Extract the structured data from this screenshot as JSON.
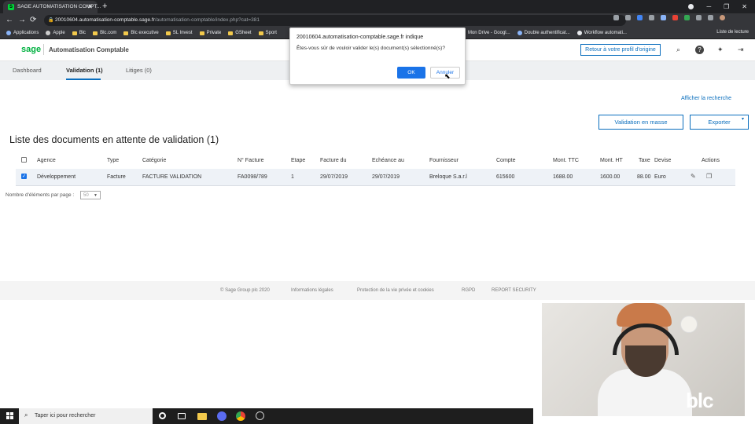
{
  "browser": {
    "tab_title": "SAGE AUTOMATISATION COMPT...",
    "url_host": "20010604.automatisation-comptable.sage.fr",
    "url_path": "/automatisation-comptable/index.php?cat=381",
    "bookmarks": [
      "Applications",
      "Apple",
      "Blc",
      "Blc.com",
      "Blc executive",
      "SL Invest",
      "Private",
      "GSheet",
      "Sport",
      "Mon Drive - Googl...",
      "Double authentificat...",
      "Workflow automati..."
    ],
    "reading_list": "Liste de lecture"
  },
  "header": {
    "logo": "sage",
    "app_title": "Automatisation Comptable",
    "return_button": "Retour à votre profil d'origine"
  },
  "tabs": [
    {
      "label": "Dashboard"
    },
    {
      "label": "Validation  (1)"
    },
    {
      "label": "Litiges  (0)"
    }
  ],
  "actions": {
    "show_search": "Afficher la recherche",
    "validate_bulk": "Validation en masse",
    "export": "Exporter"
  },
  "list": {
    "title": "Liste des documents en attente de validation (1)",
    "columns": [
      "Agence",
      "Type",
      "Catégorie",
      "N° Facture",
      "Etape",
      "Facture du",
      "Echéance au",
      "Fournisseur",
      "Compte",
      "Mont. TTC",
      "Mont. HT",
      "Taxe",
      "Devise",
      "Actions"
    ],
    "rows": [
      {
        "checked": true,
        "agence": "Développement",
        "type": "Facture",
        "categorie": "FACTURE VALIDATION",
        "numero": "FA0098/789",
        "etape": "1",
        "facture_du": "29/07/2019",
        "echeance": "29/07/2019",
        "fournisseur": "Breloque S.a.r.l",
        "compte": "615600",
        "ttc": "1688.00",
        "ht": "1600.00",
        "taxe": "88.00",
        "devise": "Euro"
      }
    ],
    "per_page_label": "Nombre d'éléments par page :",
    "per_page_value": "50"
  },
  "footer": {
    "links": [
      "© Sage Group plc 2020",
      "Informations légales",
      "Protection de la vie privée et cookies",
      "RGPD",
      "REPORT SECURITY"
    ]
  },
  "dialog": {
    "title": "20010604.automatisation-comptable.sage.fr indique",
    "message": "Êtes-vous sûr de vouloir valider le(s) document(s) sélectionné(s)?",
    "ok": "OK",
    "cancel": "Annuler"
  },
  "taskbar": {
    "search_placeholder": "Taper ici pour rechercher"
  },
  "webcam": {
    "overlay_logo": "blc"
  },
  "colors": {
    "accent": "#0a6ebd",
    "sage_green": "#00b140",
    "dialog_ok": "#1a73e8"
  }
}
